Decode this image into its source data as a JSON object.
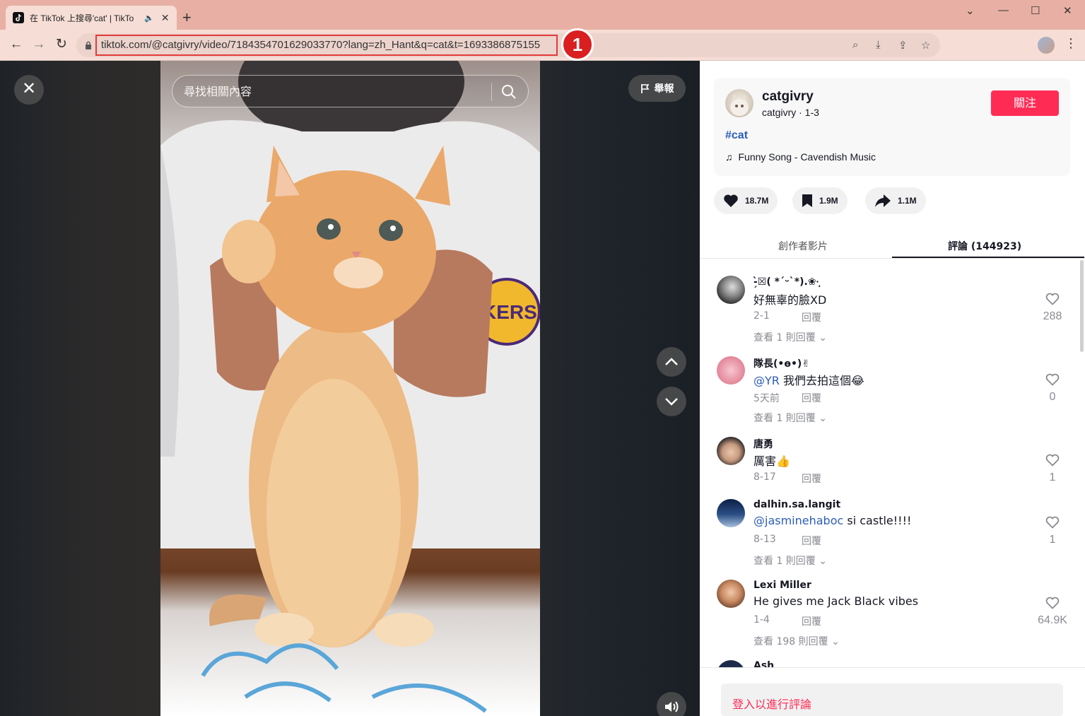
{
  "browser": {
    "tab_title": "在 TikTok 上搜尋'cat' | TikTo",
    "new_tab": "+",
    "url": "tiktok.com/@catgivry/video/7184354701629033770?lang=zh_Hant&q=cat&t=1693386875155",
    "annotation_badge": "1"
  },
  "video": {
    "search_placeholder": "尋找相關內容",
    "report_label": "舉報"
  },
  "author": {
    "name": "catgivry",
    "subline": "catgivry · 1-3",
    "follow_label": "關注",
    "hashtag": "#cat",
    "music": "Funny Song - Cavendish Music"
  },
  "stats": {
    "likes": "18.7M",
    "saves": "1.9M",
    "shares": "1.1M"
  },
  "panel_tabs": {
    "creator_videos": "創作者影片",
    "comments": "評論 (144923)"
  },
  "comments": [
    {
      "user": "-̗̀☒( *´ᵕ`*).❀·̩͙",
      "text": "好無辜的臉XD",
      "date": "2-1",
      "reply": "回覆",
      "more": "查看 1 則回覆",
      "likes": "288"
    },
    {
      "user": "隊長(•ө•)✌",
      "mention": "@YR",
      "text": " 我們去拍這個😂",
      "date": "5天前",
      "reply": "回覆",
      "more": "查看 1 則回覆",
      "likes": "0"
    },
    {
      "user": "唐勇",
      "text": "厲害👍",
      "date": "8-17",
      "reply": "回覆",
      "more": "",
      "likes": "1"
    },
    {
      "user": "dalhin.sa.langit",
      "mention": "@jasminehaboc",
      "text": " si castle!!!!",
      "date": "8-13",
      "reply": "回覆",
      "more": "查看 1 則回覆",
      "likes": "1"
    },
    {
      "user": "Lexi Miller",
      "text": "He gives me Jack Black vibes",
      "date": "1-4",
      "reply": "回覆",
      "more": "查看 198 則回覆",
      "likes": "64.9K"
    },
    {
      "user": "Ash",
      "text": "",
      "date": "",
      "reply": "",
      "more": "",
      "likes": ""
    }
  ],
  "login_prompt": "登入以進行評論",
  "colors": {
    "accent": "#fe2c55",
    "link": "#2b5db9",
    "highlight": "#e33a3a"
  }
}
